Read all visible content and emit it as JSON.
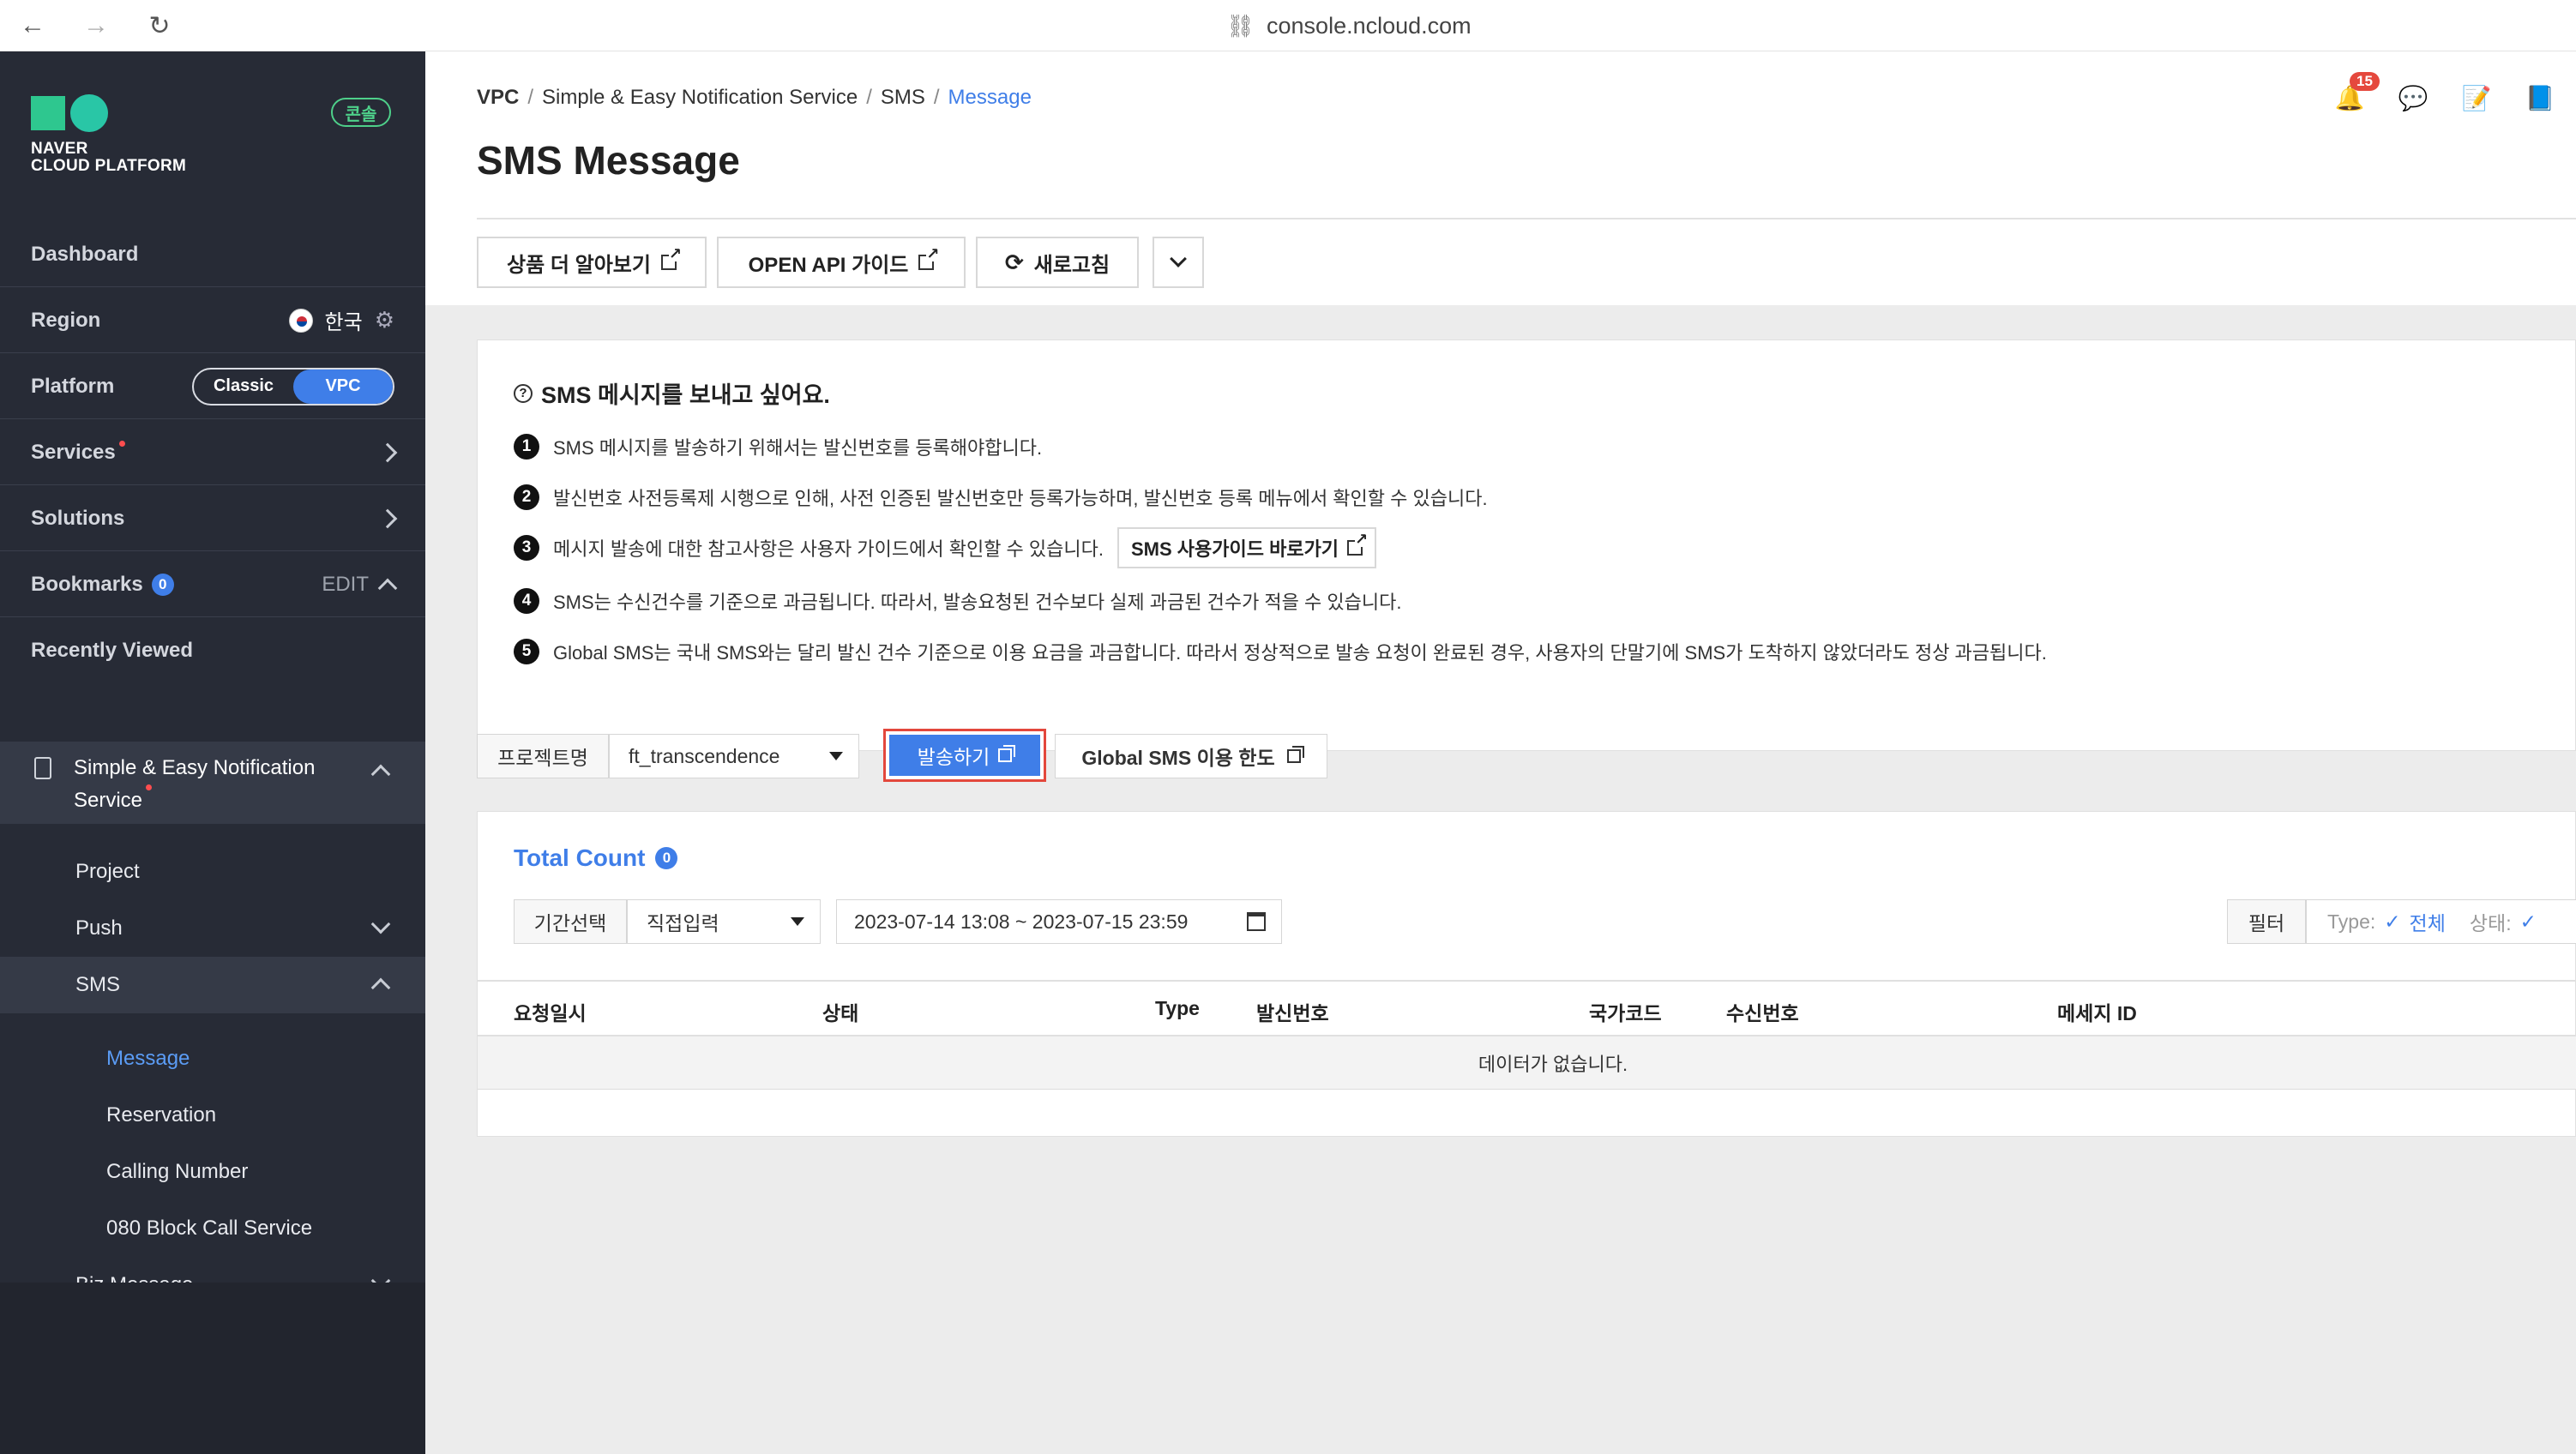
{
  "browser": {
    "back_icon": "arrow-left-icon",
    "forward_icon": "arrow-right-icon",
    "reload_icon": "reload-icon",
    "url": "console.ncloud.com"
  },
  "sidebar": {
    "logo_line1": "NAVER",
    "logo_line2": "CLOUD PLATFORM",
    "console_badge": "콘솔",
    "dashboard": "Dashboard",
    "region_label": "Region",
    "region_value": "한국",
    "platform_label": "Platform",
    "platform_classic": "Classic",
    "platform_vpc": "VPC",
    "services": "Services",
    "solutions": "Solutions",
    "bookmarks": "Bookmarks",
    "bookmarks_count": "0",
    "bookmarks_edit": "EDIT",
    "recently_viewed": "Recently Viewed",
    "service_title": "Simple & Easy Notification Service",
    "items": {
      "project": "Project",
      "push": "Push",
      "sms": "SMS",
      "message": "Message",
      "reservation": "Reservation",
      "calling_number": "Calling Number",
      "block_call": "080 Block Call Service",
      "biz_message": "Biz Message"
    }
  },
  "header": {
    "breadcrumb": [
      "VPC",
      "Simple & Easy Notification Service",
      "SMS",
      "Message"
    ],
    "title": "SMS Message",
    "notification_count": "15"
  },
  "toolbar": {
    "learn_more": "상품 더 알아보기",
    "api_guide": "OPEN API 가이드",
    "refresh": "새로고침"
  },
  "info": {
    "title": "SMS 메시지를 보내고 싶어요.",
    "lines": [
      "SMS 메시지를 발송하기 위해서는 발신번호를 등록해야합니다.",
      "발신번호 사전등록제 시행으로 인해, 사전 인증된 발신번호만 등록가능하며, 발신번호 등록 메뉴에서 확인할 수 있습니다.",
      "메시지 발송에 대한 참고사항은 사용자 가이드에서 확인할 수 있습니다.",
      "SMS는 수신건수를 기준으로 과금됩니다. 따라서, 발송요청된 건수보다 실제 과금된 건수가 적을 수 있습니다.",
      "Global SMS는 국내 SMS와는 달리 발신 건수 기준으로 이용 요금을 과금합니다. 따라서 정상적으로 발송 요청이 완료된 경우, 사용자의 단말기에 SMS가 도착하지 않았더라도 정상 과금됩니다."
    ],
    "numbers": [
      "1",
      "2",
      "3",
      "4",
      "5"
    ],
    "guide_link": "SMS 사용가이드 바로가기"
  },
  "project_bar": {
    "label": "프로젝트명",
    "selected": "ft_transcendence",
    "send_button": "발송하기",
    "global_limit": "Global SMS 이용 한도"
  },
  "list": {
    "total_label": "Total Count",
    "total_count": "0",
    "period_label": "기간선택",
    "period_mode": "직접입력",
    "date_range": "2023-07-14 13:08 ~ 2023-07-15 23:59",
    "filter_button": "필터",
    "filter_type_label": "Type:",
    "filter_type_value": "전체",
    "filter_status_label": "상태:",
    "columns": [
      "요청일시",
      "상태",
      "Type",
      "발신번호",
      "국가코드",
      "수신번호",
      "메세지 ID"
    ],
    "empty_text": "데이터가 없습니다."
  },
  "colors": {
    "accent": "#3f7ee8",
    "highlight": "#e3473c",
    "sidebar_bg": "#272b36"
  }
}
